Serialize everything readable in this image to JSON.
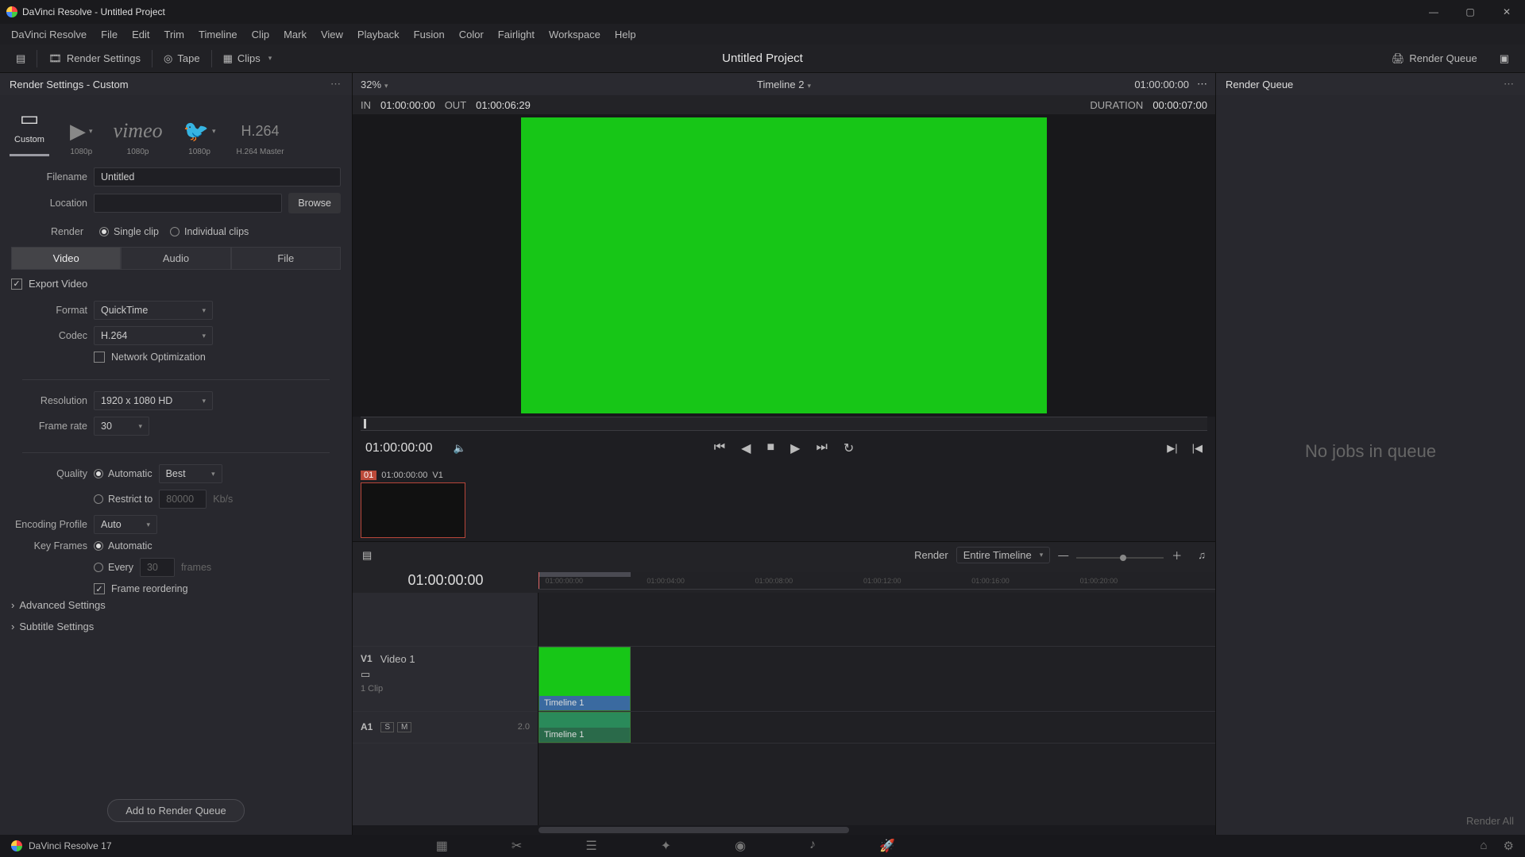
{
  "title": "DaVinci Resolve - Untitled Project",
  "menu": [
    "DaVinci Resolve",
    "File",
    "Edit",
    "Trim",
    "Timeline",
    "Clip",
    "Mark",
    "View",
    "Playback",
    "Fusion",
    "Color",
    "Fairlight",
    "Workspace",
    "Help"
  ],
  "toolbar": {
    "render_settings": "Render Settings",
    "tape": "Tape",
    "clips": "Clips",
    "project": "Untitled Project",
    "render_queue": "Render Queue"
  },
  "left": {
    "heading": "Render Settings - Custom",
    "presets": [
      {
        "name": "Custom",
        "sub": "Custom",
        "glyph": "▭"
      },
      {
        "name": "YouTube",
        "sub": "1080p",
        "glyph": "▶"
      },
      {
        "name": "Vimeo",
        "sub": "1080p",
        "glyph": "vimeo"
      },
      {
        "name": "Twitter",
        "sub": "1080p",
        "glyph": "𝕏"
      },
      {
        "name": "H.264",
        "sub": "H.264 Master",
        "glyph": "H.264"
      }
    ],
    "filename_lbl": "Filename",
    "filename": "Untitled",
    "location_lbl": "Location",
    "location": "",
    "browse": "Browse",
    "render_lbl": "Render",
    "single_clip": "Single clip",
    "individual_clips": "Individual clips",
    "tabs": {
      "video": "Video",
      "audio": "Audio",
      "file": "File"
    },
    "export_video": "Export Video",
    "format_lbl": "Format",
    "format": "QuickTime",
    "codec_lbl": "Codec",
    "codec": "H.264",
    "network_opt": "Network Optimization",
    "resolution_lbl": "Resolution",
    "resolution": "1920 x 1080 HD",
    "framerate_lbl": "Frame rate",
    "framerate": "30",
    "quality_lbl": "Quality",
    "quality_auto": "Automatic",
    "quality_best": "Best",
    "restrict_to": "Restrict to",
    "restrict_val": "80000",
    "restrict_unit": "Kb/s",
    "encprof_lbl": "Encoding Profile",
    "encprof": "Auto",
    "keyframes_lbl": "Key Frames",
    "kf_auto": "Automatic",
    "kf_every": "Every",
    "kf_n": "30",
    "kf_unit": "frames",
    "frame_reorder": "Frame reordering",
    "advanced": "Advanced Settings",
    "subtitle": "Subtitle Settings",
    "add_to_queue": "Add to Render Queue"
  },
  "viewer": {
    "zoom": "32%",
    "timeline_name": "Timeline 2",
    "in_lbl": "IN",
    "in_tc": "01:00:00:00",
    "out_lbl": "OUT",
    "out_tc": "01:00:06:29",
    "dur_lbl": "DURATION",
    "dur_tc": "00:00:07:00",
    "head_tc": "01:00:00:00",
    "transport_tc": "01:00:00:00",
    "thumb": {
      "n": "01",
      "tc": "01:00:00:00",
      "trk": "V1"
    }
  },
  "timeline": {
    "render_lbl": "Render",
    "render_mode": "Entire Timeline",
    "big_tc": "01:00:00:00",
    "ticks": [
      "01:00:00:00",
      "01:00:04:00",
      "01:00:08:00",
      "01:00:12:00",
      "01:00:16:00",
      "01:00:20:00"
    ],
    "v1_tag": "V1",
    "v1_name": "Video 1",
    "v1_sub": "1 Clip",
    "a1_tag": "A1",
    "a1_sm": [
      "S",
      "M"
    ],
    "a1_db": "2.0",
    "clip_label": "Timeline 1"
  },
  "right": {
    "heading": "Render Queue",
    "empty": "No jobs in queue",
    "render_all": "Render All"
  },
  "brand": "DaVinci Resolve 17"
}
